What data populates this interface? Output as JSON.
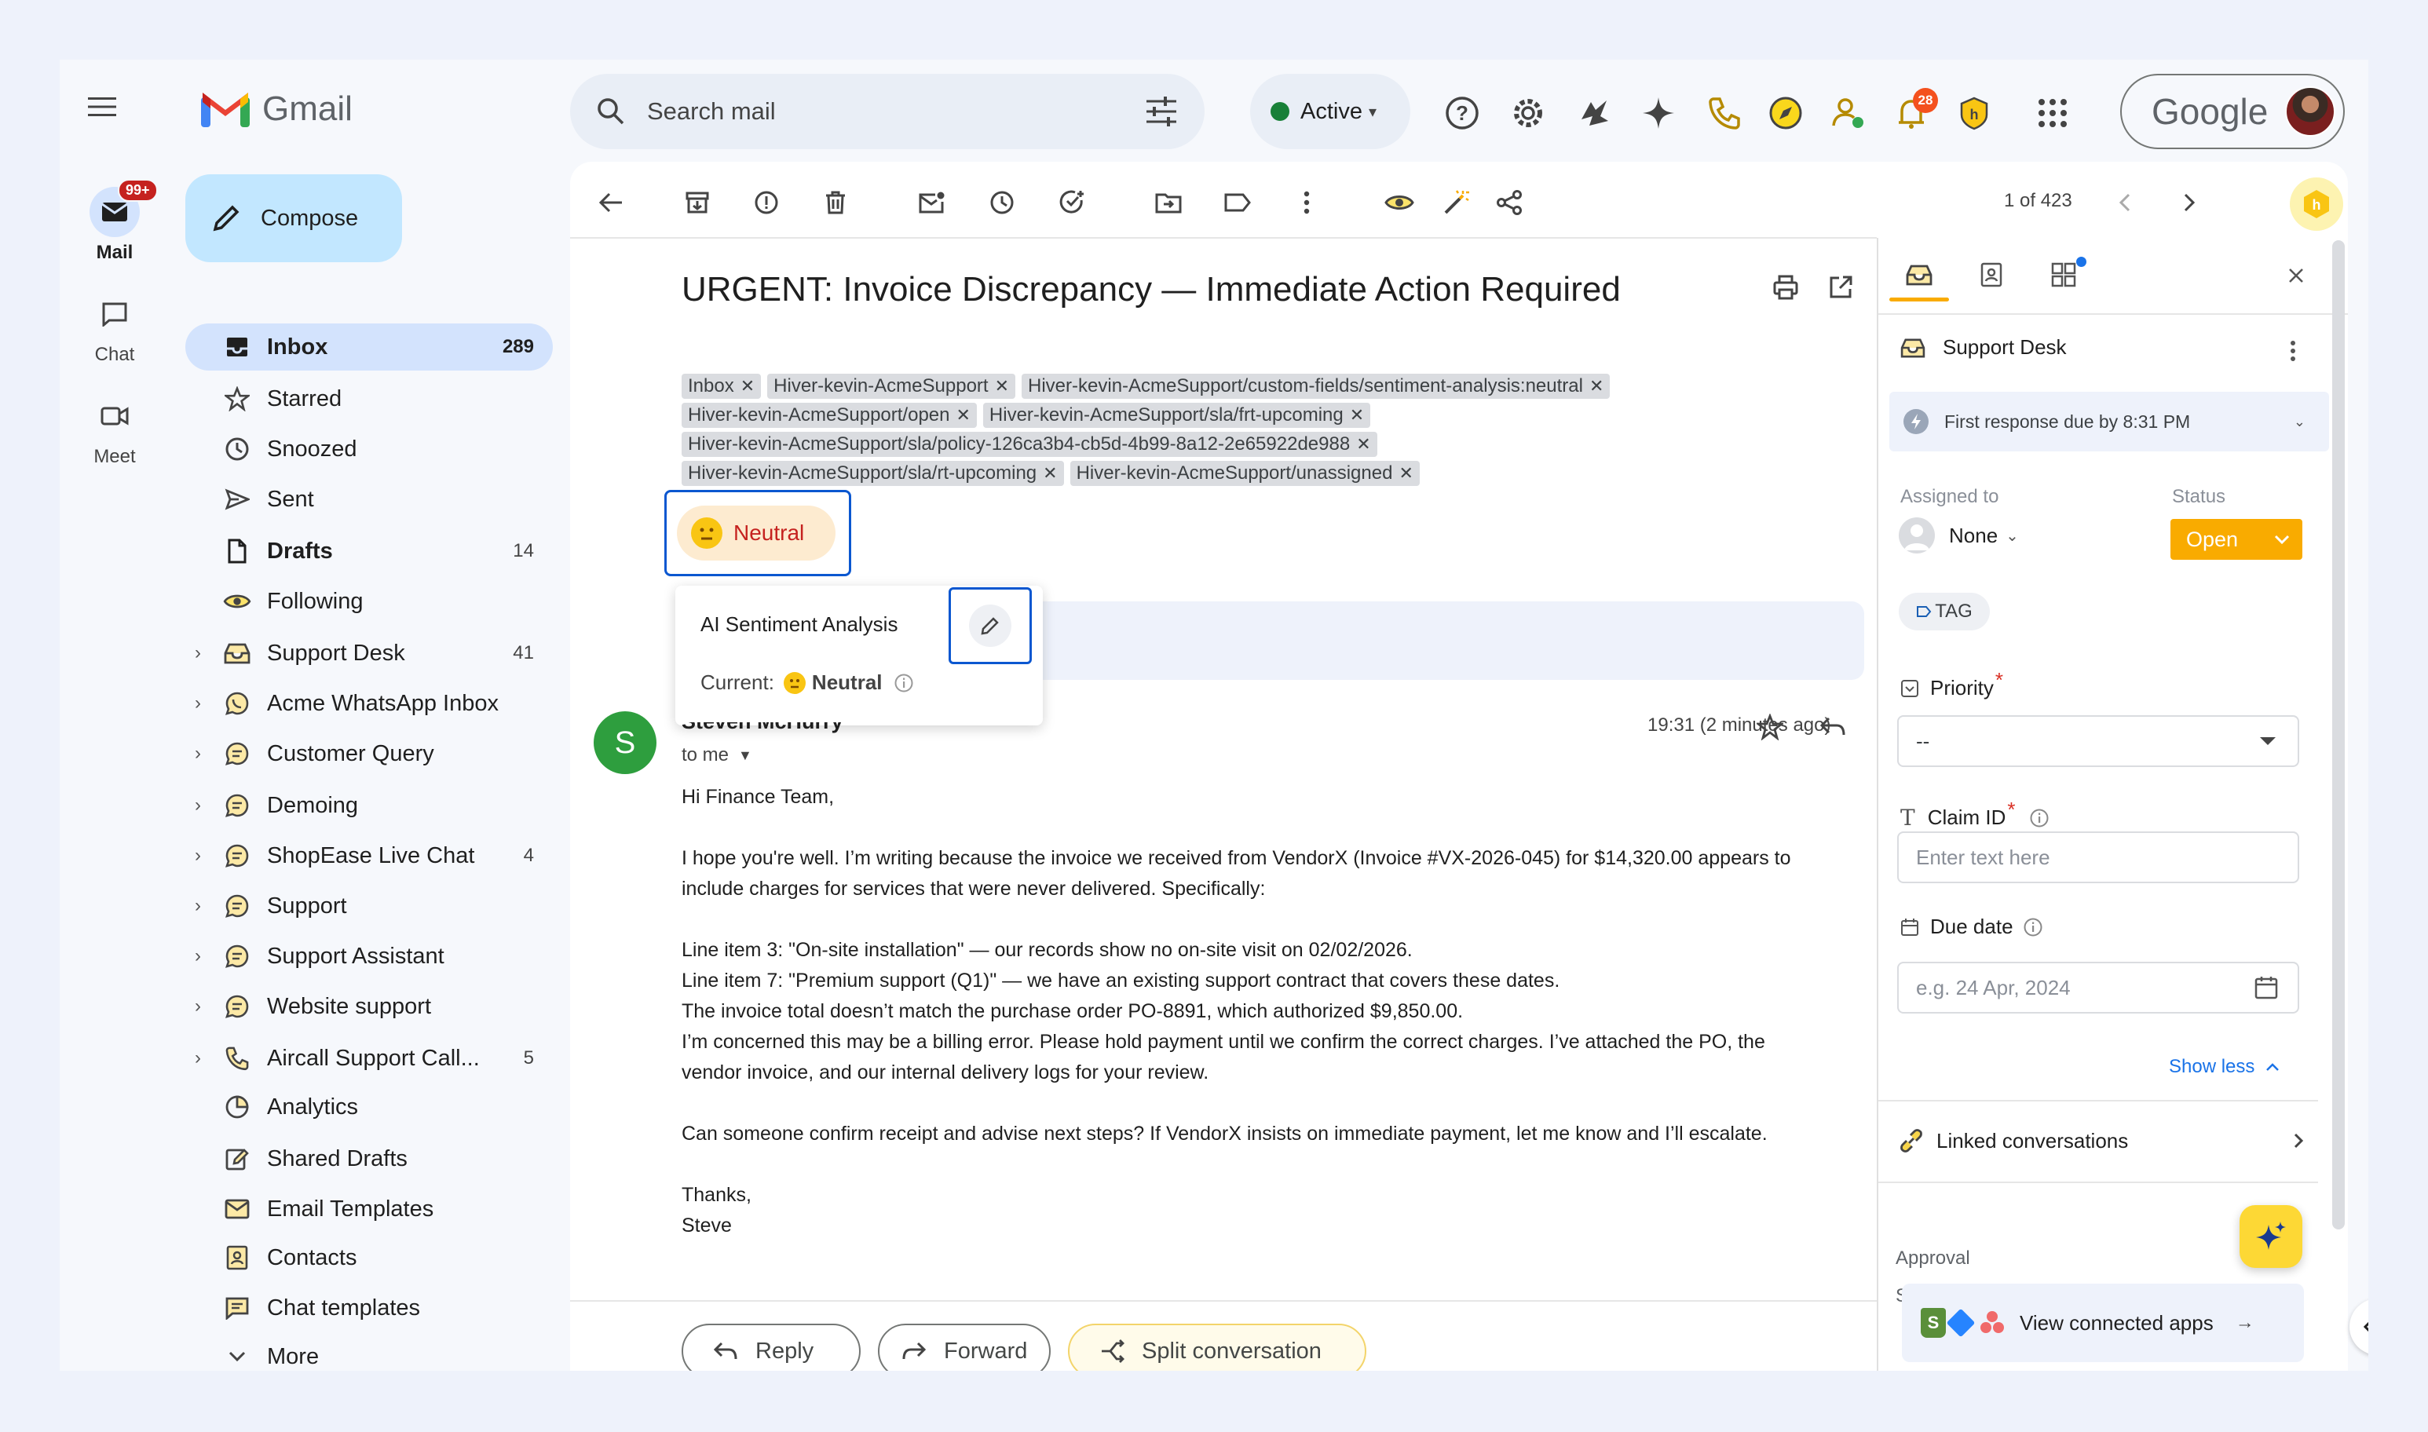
{
  "app": {
    "name": "Gmail",
    "brand_logo": "Google"
  },
  "rail": [
    {
      "label": "Mail",
      "badge": "99+",
      "icon": "mail-icon"
    },
    {
      "label": "Chat",
      "icon": "chat-icon"
    },
    {
      "label": "Meet",
      "icon": "video-icon"
    }
  ],
  "compose_label": "Compose",
  "nav": [
    {
      "label": "Inbox",
      "count": "289",
      "icon": "inbox-icon",
      "active": true
    },
    {
      "label": "Starred",
      "count": "",
      "icon": "star-icon"
    },
    {
      "label": "Snoozed",
      "count": "",
      "icon": "clock-icon"
    },
    {
      "label": "Sent",
      "count": "",
      "icon": "send-icon"
    },
    {
      "label": "Drafts",
      "count": "14",
      "icon": "draft-icon",
      "bold": true
    },
    {
      "label": "Following",
      "count": "",
      "icon": "eye-icon"
    },
    {
      "label": "Support Desk",
      "count": "41",
      "icon": "shared-inbox-icon",
      "expand": true
    },
    {
      "label": "Acme WhatsApp Inbox",
      "count": "",
      "icon": "whatsapp-icon",
      "expand": true
    },
    {
      "label": "Customer Query",
      "count": "",
      "icon": "chat-bubble-icon",
      "expand": true
    },
    {
      "label": "Demoing",
      "count": "",
      "icon": "chat-bubble-icon",
      "expand": true
    },
    {
      "label": "ShopEase Live Chat",
      "count": "4",
      "icon": "chat-bubble-icon",
      "expand": true
    },
    {
      "label": "Support",
      "count": "",
      "icon": "chat-bubble-icon",
      "expand": true
    },
    {
      "label": "Support Assistant",
      "count": "",
      "icon": "chat-bubble-icon",
      "expand": true
    },
    {
      "label": "Website support",
      "count": "",
      "icon": "chat-bubble-icon",
      "expand": true
    },
    {
      "label": "Aircall Support Call...",
      "count": "5",
      "icon": "phone-icon",
      "expand": true
    },
    {
      "label": "Analytics",
      "count": "",
      "icon": "analytics-icon"
    },
    {
      "label": "Shared Drafts",
      "count": "",
      "icon": "shared-drafts-icon"
    },
    {
      "label": "Email Templates",
      "count": "",
      "icon": "email-template-icon"
    },
    {
      "label": "Contacts",
      "count": "",
      "icon": "contacts-icon"
    },
    {
      "label": "Chat templates",
      "count": "",
      "icon": "chat-template-icon"
    },
    {
      "label": "More",
      "count": "",
      "icon": "chevron-down-icon"
    }
  ],
  "search": {
    "placeholder": "Search mail"
  },
  "status": {
    "label": "Active"
  },
  "notif_badge": "28",
  "pager": {
    "text": "1 of 423"
  },
  "email": {
    "subject": "URGENT: Invoice Discrepancy — Immediate Action Required",
    "labels": [
      "Inbox",
      "Hiver-kevin-AcmeSupport",
      "Hiver-kevin-AcmeSupport/custom-fields/sentiment-analysis:neutral",
      "Hiver-kevin-AcmeSupport/open",
      "Hiver-kevin-AcmeSupport/sla/frt-upcoming",
      "Hiver-kevin-AcmeSupport/sla/policy-126ca3b4-cb5d-4b99-8a12-2e65922de988",
      "Hiver-kevin-AcmeSupport/sla/rt-upcoming",
      "Hiver-kevin-AcmeSupport/unassigned"
    ],
    "sentiment_chip": "Neutral",
    "popup": {
      "title": "AI Sentiment Analysis",
      "current_label": "Current:",
      "current_value": "Neutral"
    },
    "sender": {
      "initial": "S",
      "name": "Steven McHurry",
      "to": "to me",
      "time": "19:31 (2 minutes ago)"
    },
    "body": [
      "Hi Finance Team,",
      "",
      "I hope you're well. I’m writing because the invoice we received from VendorX (Invoice #VX-2026-045) for $14,320.00 appears to",
      "include charges for services that were never delivered. Specifically:",
      "",
      "Line item 3: \"On-site installation\" — our records show no on-site visit on 02/02/2026.",
      "Line item 7: \"Premium support (Q1)\" — we have an existing support contract that covers these dates.",
      "The invoice total doesn’t match the purchase order PO-8891, which authorized $9,850.00.",
      "I’m concerned this may be a billing error. Please hold payment until we confirm the correct charges. I’ve attached the PO, the",
      "vendor invoice, and our internal delivery logs for your review.",
      "",
      "Can someone confirm receipt and advise next steps? If VendorX insists on immediate payment, let me know and I’ll escalate.",
      "",
      "Thanks,",
      "Steve"
    ],
    "actions": {
      "reply": "Reply",
      "forward": "Forward",
      "split": "Split conversation"
    }
  },
  "panel": {
    "inbox_name": "Support Desk",
    "sla_text": "First response due by 8:31 PM",
    "assigned_label": "Assigned to",
    "assigned_value": "None",
    "status_label": "Status",
    "status_value": "Open",
    "tag_label": "TAG",
    "priority_label": "Priority",
    "priority_required": "*",
    "priority_value": "--",
    "claim_label": "Claim ID",
    "claim_required": "*",
    "claim_placeholder": "Enter text here",
    "due_label": "Due date",
    "due_placeholder": "e.g. 24 Apr, 2024",
    "show_less": "Show less",
    "linked_label": "Linked conversations",
    "approval_label": "Approval",
    "approval_fragment": "S",
    "connected_apps": "View connected apps"
  },
  "colors": {
    "accent": "#0b57d0",
    "status_open": "#f9ab00",
    "hiver_yellow": "#fdd835",
    "avatar_green": "#2e9e3e"
  }
}
